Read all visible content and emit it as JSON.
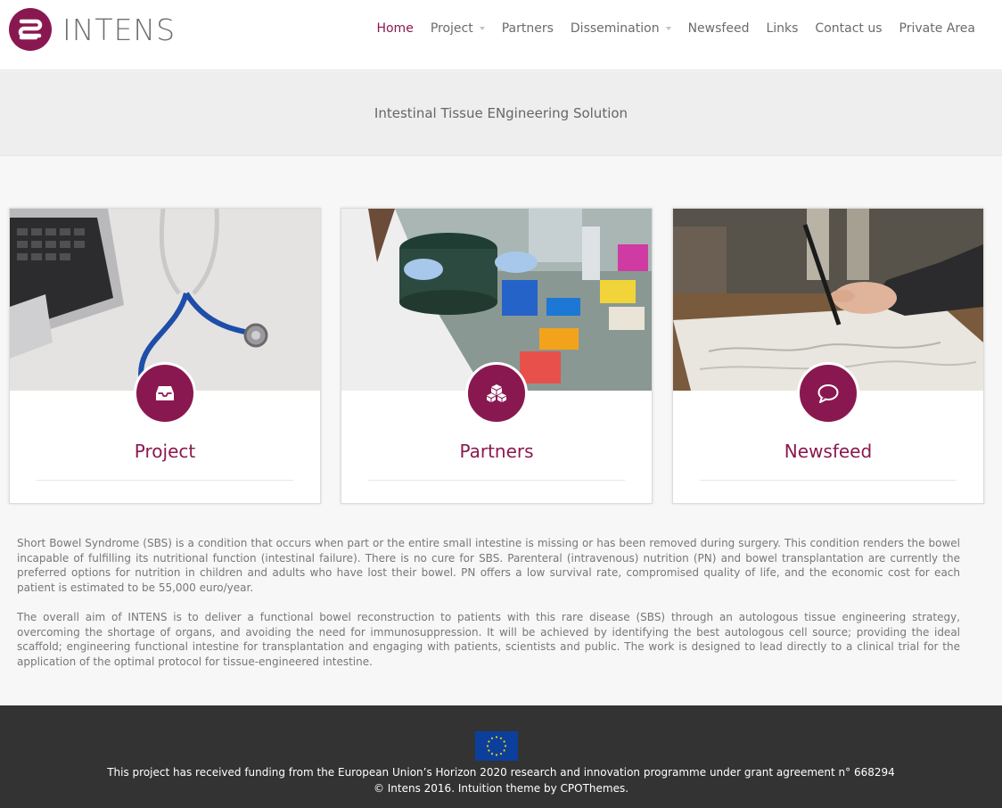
{
  "brand": {
    "name": "INTENS",
    "accent": "#8a1850"
  },
  "nav": {
    "items": [
      {
        "label": "Home",
        "active": true,
        "dropdown": false
      },
      {
        "label": "Project",
        "active": false,
        "dropdown": true
      },
      {
        "label": "Partners",
        "active": false,
        "dropdown": false
      },
      {
        "label": "Dissemination",
        "active": false,
        "dropdown": true
      },
      {
        "label": "Newsfeed",
        "active": false,
        "dropdown": false
      },
      {
        "label": "Links",
        "active": false,
        "dropdown": false
      },
      {
        "label": "Contact us",
        "active": false,
        "dropdown": false
      },
      {
        "label": "Private Area",
        "active": false,
        "dropdown": false
      }
    ]
  },
  "tagline": "Intestinal Tissue ENgineering Solution",
  "cards": [
    {
      "title": "Project",
      "icon": "inbox-icon",
      "image": "stethoscope-laptop-photo"
    },
    {
      "title": "Partners",
      "icon": "cubes-icon",
      "image": "laboratory-photo"
    },
    {
      "title": "Newsfeed",
      "icon": "speech-bubble-icon",
      "image": "writing-hand-photo"
    }
  ],
  "content": {
    "paragraphs": [
      "Short Bowel Syndrome (SBS) is a condition that occurs when part or the entire small intestine is missing or has been removed during surgery. This condition renders the bowel incapable of fulfilling its nutritional function (intestinal failure). There is no cure for SBS. Parenteral (intravenous) nutrition (PN) and bowel transplantation are currently the preferred options for nutrition in children and adults who have lost their bowel. PN offers a low survival rate, compromised quality of life, and the economic cost for each patient is estimated to be 55,000 euro/year.",
      "The overall aim of INTENS is to deliver a functional bowel reconstruction to patients with this rare disease (SBS) through an autologous tissue engineering strategy, overcoming the shortage of organs, and avoiding the need for immunosuppression. It will be achieved by identifying the best autologous cell source; providing the ideal scaffold; engineering functional intestine for transplantation and engaging with patients, scientists and public. The work is designed to lead directly to a clinical trial for the application of the optimal protocol for tissue-engineered intestine."
    ]
  },
  "footer": {
    "flag": "eu-flag-icon",
    "funding": "This project has received funding from the European Union’s Horizon 2020 research and innovation programme under grant agreement n° 668294",
    "copyright": "© Intens 2016. Intuition theme by CPOThemes."
  }
}
